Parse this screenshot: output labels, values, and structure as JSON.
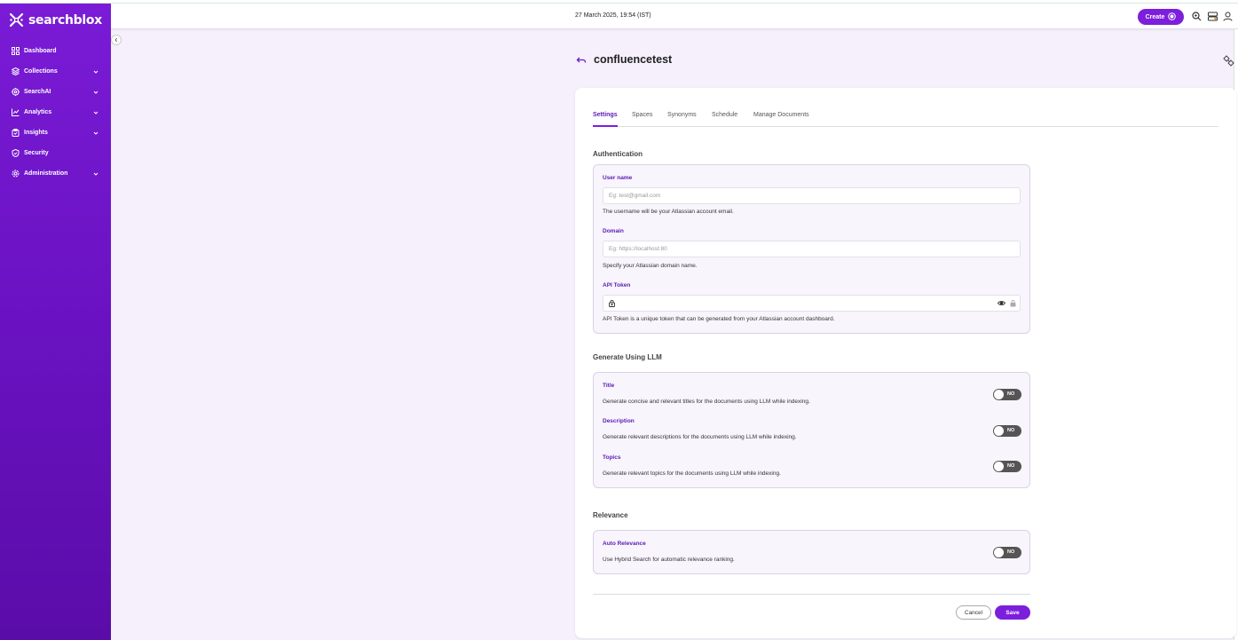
{
  "app": {
    "logo_text": "searchblox"
  },
  "sidebar": {
    "items": [
      {
        "label": "Dashboard",
        "icon": "grid-icon",
        "has_chevron": false
      },
      {
        "label": "Collections",
        "icon": "layers-icon",
        "has_chevron": true
      },
      {
        "label": "SearchAI",
        "icon": "gear-ai-icon",
        "has_chevron": true
      },
      {
        "label": "Analytics",
        "icon": "chart-icon",
        "has_chevron": true
      },
      {
        "label": "Insights",
        "icon": "clipboard-icon",
        "has_chevron": true
      },
      {
        "label": "Security",
        "icon": "shield-icon",
        "has_chevron": false
      },
      {
        "label": "Administration",
        "icon": "settings-icon",
        "has_chevron": true
      }
    ]
  },
  "header": {
    "datetime": "27 March 2025, 19:54 (IST)",
    "create_label": "Create",
    "icons": [
      "search-icon",
      "server-icon",
      "user-icon"
    ]
  },
  "page": {
    "title": "confluencetest"
  },
  "tabs": [
    "Settings",
    "Spaces",
    "Synonyms",
    "Schedule",
    "Manage Documents"
  ],
  "active_tab": "Settings",
  "authentication": {
    "title": "Authentication",
    "username": {
      "label": "User name",
      "placeholder": "Eg: test@gmail.com",
      "help": "The username will be your Atlassian account email."
    },
    "domain": {
      "label": "Domain",
      "placeholder": "Eg: https://localhost:80",
      "help": "Specify your Atlassian domain name."
    },
    "api_token": {
      "label": "API Token",
      "value": "",
      "help": "API Token is a unique token that can be generated from your Atlassian account dashboard."
    }
  },
  "llm": {
    "title": "Generate Using LLM",
    "items": [
      {
        "label": "Title",
        "help": "Generate concise and relevant titles for the documents using LLM while indexing.",
        "state": "NO"
      },
      {
        "label": "Description",
        "help": "Generate relevant descriptions for the documents using LLM while indexing.",
        "state": "NO"
      },
      {
        "label": "Topics",
        "help": "Generate relevant topics for the documents using LLM while indexing.",
        "state": "NO"
      }
    ]
  },
  "relevance": {
    "title": "Relevance",
    "auto": {
      "label": "Auto Relevance",
      "help": "Use Hybrid Search for automatic relevance ranking.",
      "state": "NO"
    }
  },
  "actions": {
    "cancel": "Cancel",
    "save": "Save"
  },
  "colors": {
    "brand": "#7c1fdc",
    "active_tab": "#5b1ab5",
    "toggle_off": "#555555"
  }
}
